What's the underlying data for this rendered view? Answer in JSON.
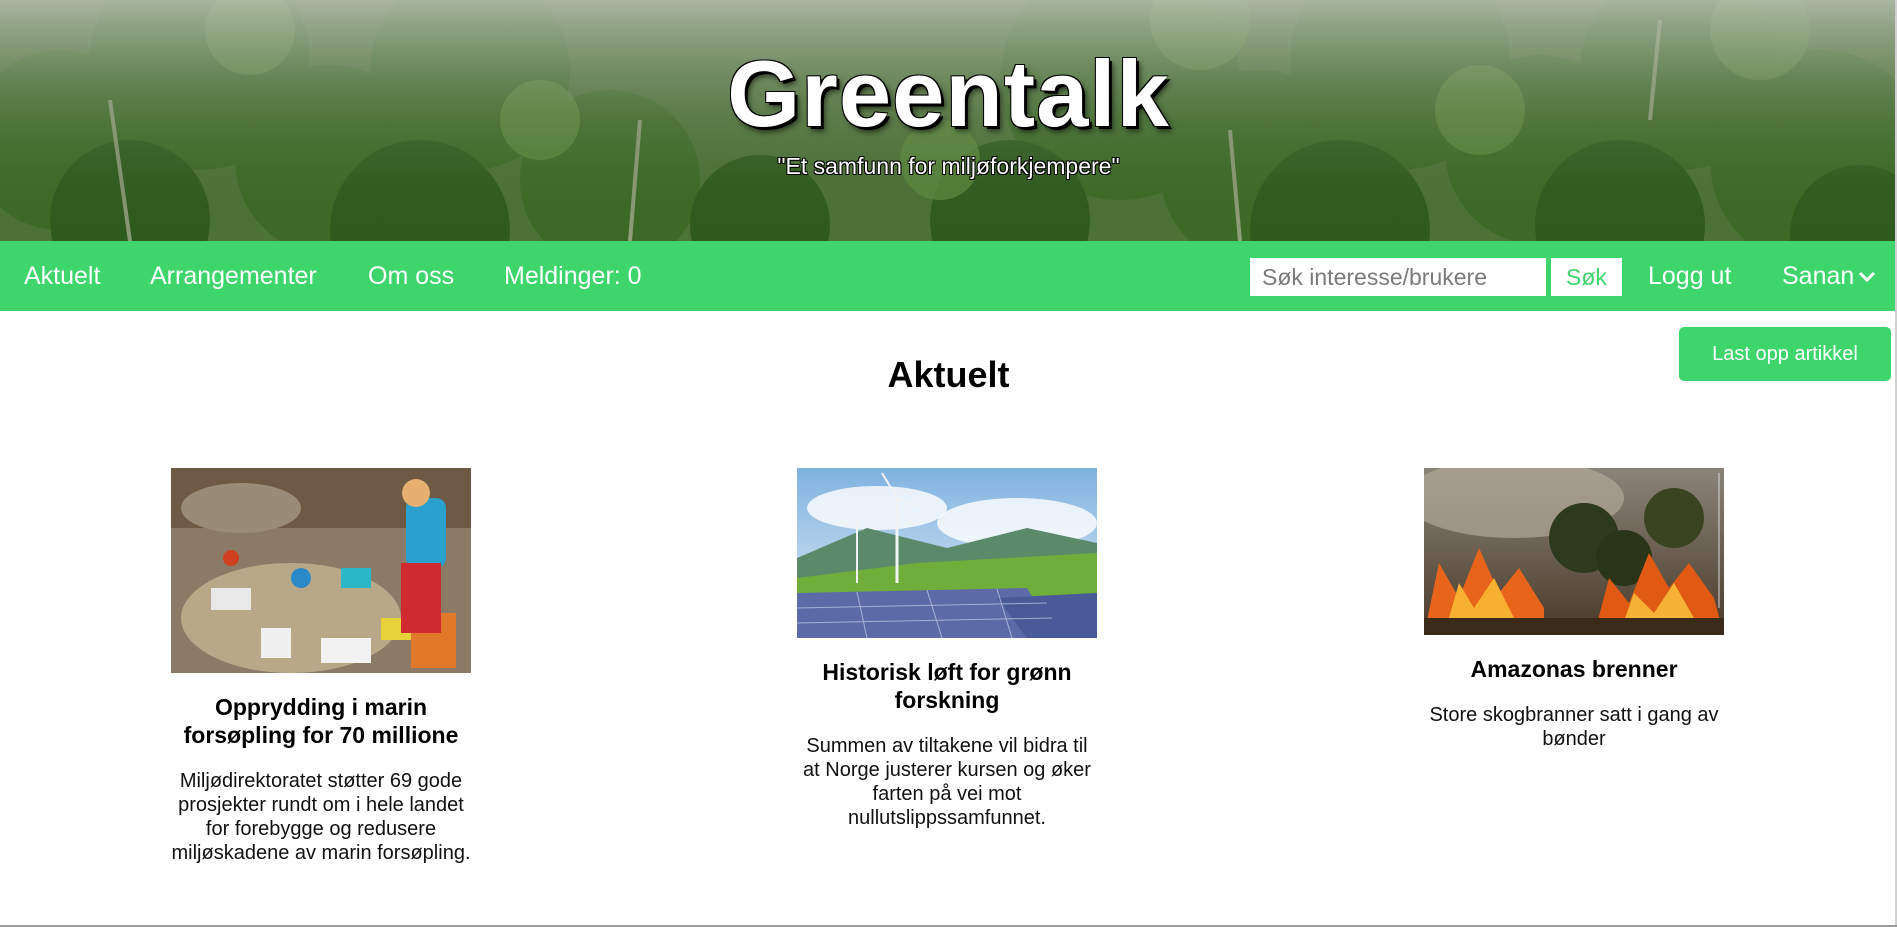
{
  "hero": {
    "title": "Greentalk",
    "tagline": "\"Et samfunn for miljøforkjempere\""
  },
  "nav": {
    "items": [
      {
        "label": "Aktuelt"
      },
      {
        "label": "Arrangementer"
      },
      {
        "label": "Om oss"
      },
      {
        "label": "Meldinger: 0"
      }
    ],
    "search_placeholder": "Søk interesse/brukere",
    "search_button": "Søk",
    "logout": "Logg ut",
    "user": "Sanan"
  },
  "upload_button": "Last opp artikkel",
  "page_title": "Aktuelt",
  "articles": [
    {
      "title": "Opprydding i marin forsøpling for 70 millione",
      "body": "Miljødirektoratet støtter 69 gode prosjekter rundt om i hele landet for forebygge og redusere miljøskadene av marin forsøpling."
    },
    {
      "title": "Historisk løft for grønn forskning",
      "body": "Summen av tiltakene vil bidra til at Norge justerer kursen og øker farten på vei mot nullutslippssamfunnet."
    },
    {
      "title": "Amazonas brenner",
      "body": "Store skogbranner satt i gang av bønder"
    }
  ],
  "colors": {
    "brand_green": "#3ed66c",
    "text": "#000000"
  }
}
